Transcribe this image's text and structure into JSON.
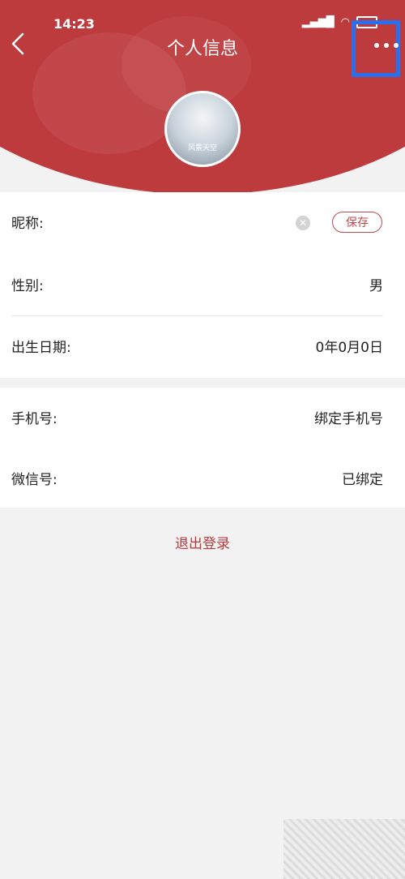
{
  "status_bar": {
    "time": "14:23"
  },
  "header": {
    "title": "个人信息"
  },
  "avatar": {
    "caption": "风景天空"
  },
  "profile": {
    "nickname_label": "昵称:",
    "save_label": "保存",
    "gender_label": "性别:",
    "gender_value": "男",
    "birth_label": "出生日期:",
    "birth_value": "0年0月0日"
  },
  "account": {
    "phone_label": "手机号:",
    "phone_value": "绑定手机号",
    "wechat_label": "微信号:",
    "wechat_value": "已绑定"
  },
  "logout_label": "退出登录",
  "colors": {
    "brand": "#bd3a3d",
    "highlight": "#2a6ff0"
  }
}
